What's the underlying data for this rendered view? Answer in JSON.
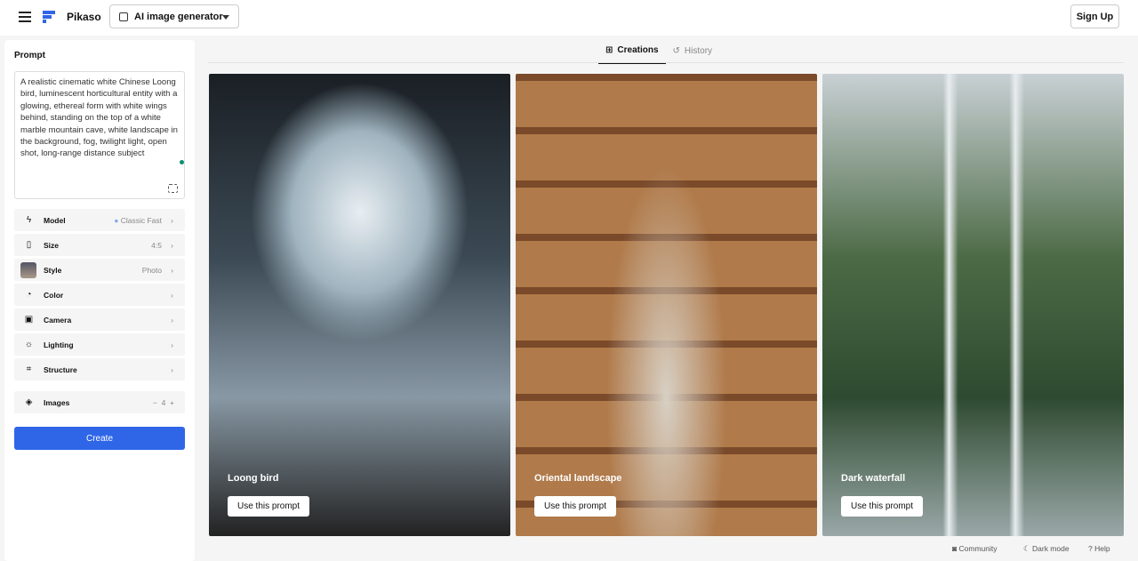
{
  "header": {
    "brand": "Pikaso",
    "tool": "AI image generator",
    "signup": "Sign Up"
  },
  "sidebar": {
    "prompt_label": "Prompt",
    "prompt": "A realistic cinematic white Chinese Loong bird, luminescent horticultural entity with a glowing, ethereal form with white wings behind, standing on the top of a white marble mountain cave, white landscape in the background, fog, twilight light, open shot, long-range distance subject",
    "options": [
      {
        "label": "Model",
        "value": "Classic Fast",
        "icon": "bolt-icon"
      },
      {
        "label": "Size",
        "value": "4:5",
        "icon": "rectangle-icon"
      },
      {
        "label": "Style",
        "value": "Photo",
        "icon": "style-thumbnail"
      },
      {
        "label": "Color",
        "value": "",
        "icon": "palette-icon"
      },
      {
        "label": "Camera",
        "value": "",
        "icon": "camera-icon"
      },
      {
        "label": "Lighting",
        "value": "",
        "icon": "sun-icon"
      },
      {
        "label": "Structure",
        "value": "",
        "icon": "structure-icon"
      }
    ],
    "images": {
      "label": "Images",
      "value": "4"
    },
    "create": "Create"
  },
  "tabs": [
    "Creations",
    "History"
  ],
  "cards": [
    {
      "title": "Loong bird",
      "button": "Use this prompt"
    },
    {
      "title": "Oriental landscape",
      "button": "Use this prompt"
    },
    {
      "title": "Dark waterfall",
      "button": "Use this prompt"
    }
  ],
  "footer": {
    "community": "Community",
    "dark": "Dark mode",
    "help": "Help"
  },
  "colors": {
    "accent": "#2f66e8"
  }
}
